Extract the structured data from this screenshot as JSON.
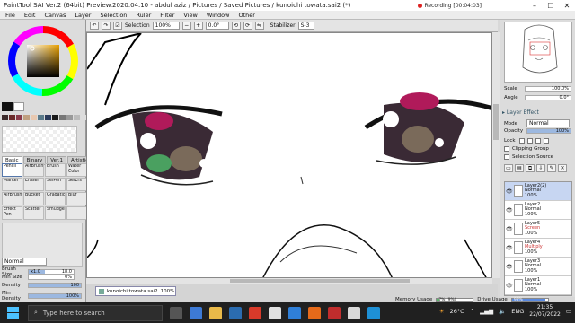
{
  "window": {
    "title": "PaintTool SAI Ver.2 (64bit) Preview.2020.04.10 - abdul aziz / Pictures / Saved Pictures / kunoichi towata.sai2 (*)",
    "recording": "Recording [00:04:03]"
  },
  "menu": [
    "File",
    "Edit",
    "Canvas",
    "Layer",
    "Selection",
    "Ruler",
    "Filter",
    "View",
    "Window",
    "Other"
  ],
  "toolbar": {
    "selection_label": "Selection",
    "zoom": "100%",
    "angle": "0.0°",
    "stabilizer_label": "Stabilizer",
    "stabilizer_value": "S-3"
  },
  "tool_tabs": [
    "Basic",
    "Binary",
    "Ver.1",
    "Artistic"
  ],
  "tools": [
    {
      "name": "Pencil",
      "selected": true
    },
    {
      "name": "AirBrush",
      "selected": false
    },
    {
      "name": "Brush",
      "selected": false
    },
    {
      "name": "Water Color",
      "selected": false
    },
    {
      "name": "Marker",
      "selected": false
    },
    {
      "name": "Eraser",
      "selected": false
    },
    {
      "name": "SelPen",
      "selected": false
    },
    {
      "name": "SelErs",
      "selected": false
    },
    {
      "name": "AirBrush",
      "selected": false
    },
    {
      "name": "Bucket",
      "selected": false
    },
    {
      "name": "Gradation",
      "selected": false
    },
    {
      "name": "Blur",
      "selected": false
    },
    {
      "name": "Effect Pen",
      "selected": false
    },
    {
      "name": "Scatter",
      "selected": false
    },
    {
      "name": "Smudge",
      "selected": false
    },
    {
      "name": "",
      "selected": false
    }
  ],
  "brush": {
    "mode": "Normal",
    "size_label": "Brush Size",
    "size_mult": "x1.0",
    "size_value": "18.0",
    "min_size_label": "Min Size",
    "min_size_value": "0%",
    "density_label": "Density",
    "density_value": "100",
    "min_density_label": "Min Density",
    "min_density_value": "100%"
  },
  "swatch_colors": [
    "#3a2a2a",
    "#6a2a2a",
    "#8a3a4a",
    "#c0a080",
    "#e8c8b0",
    "#5a7a8a",
    "#2a3a5a",
    "#1a1a1a",
    "#777",
    "#999",
    "#bbb",
    "#ddd"
  ],
  "document_tab": {
    "name": "kunoichi towata.sai2",
    "zoom": "100%"
  },
  "status": {
    "memory_label": "Memory Usage",
    "memory_value": "7% (9%)",
    "memory_fraction": 0.07,
    "drive_label": "Drive Usage",
    "drive_value": "93%",
    "drive_fraction": 0.93
  },
  "navigator": {
    "scale_label": "Scale",
    "scale_value": "100.0%",
    "angle_label": "Angle",
    "angle_value": "0.0°"
  },
  "layer_panel": {
    "section": "Layer Effect",
    "mode_label": "Mode",
    "mode_value": "Normal",
    "opacity_label": "Opacity",
    "opacity_value": "100%",
    "lock_label": "Lock",
    "clipping_label": "Clipping Group",
    "selection_source_label": "Selection Source"
  },
  "layers": [
    {
      "name": "Layer2(2)",
      "mode": "Normal",
      "opacity": "100%",
      "active": true,
      "mode_red": false
    },
    {
      "name": "Layer2",
      "mode": "Normal",
      "opacity": "100%",
      "active": false,
      "mode_red": false
    },
    {
      "name": "Layer5",
      "mode": "Screen",
      "opacity": "100%",
      "active": false,
      "mode_red": true
    },
    {
      "name": "Layer4",
      "mode": "Multiply",
      "opacity": "100%",
      "active": false,
      "mode_red": true
    },
    {
      "name": "Layer3",
      "mode": "Normal",
      "opacity": "100%",
      "active": false,
      "mode_red": false
    },
    {
      "name": "Layer1",
      "mode": "Normal",
      "opacity": "100%",
      "active": false,
      "mode_red": false
    }
  ],
  "taskbar": {
    "search_placeholder": "Type here to search",
    "weather": "26°C",
    "language": "ENG",
    "time": "21:35",
    "date": "22/07/2022"
  }
}
